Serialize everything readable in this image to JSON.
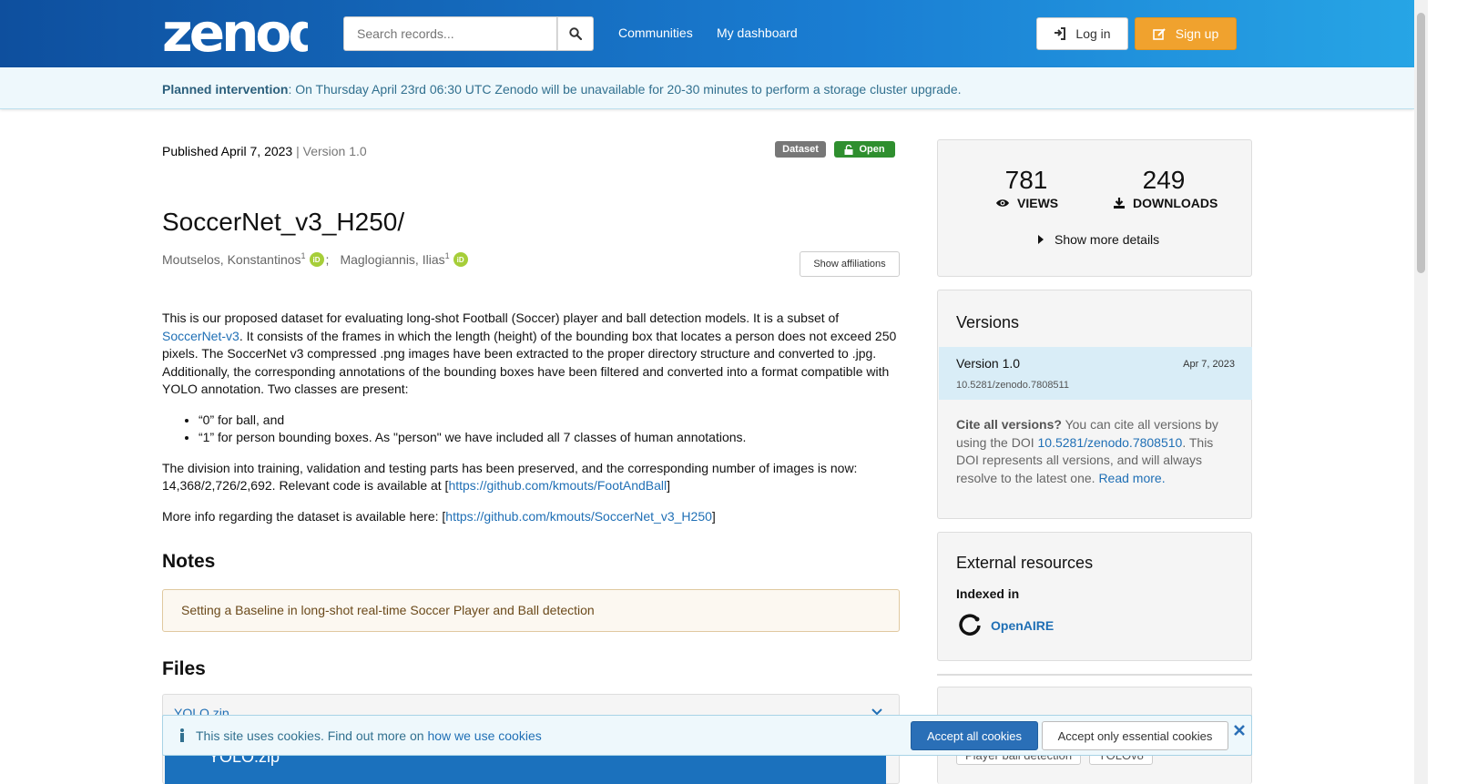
{
  "header": {
    "logo_text": "zenodo",
    "search_placeholder": "Search records...",
    "nav": [
      "Communities",
      "My dashboard"
    ],
    "login_label": "Log in",
    "signup_label": "Sign up"
  },
  "banner": {
    "bold": "Planned intervention",
    "text": ": On Thursday April 23rd 06:30 UTC Zenodo will be unavailable for 20-30 minutes to perform a storage cluster upgrade."
  },
  "record": {
    "published": "Published April 7, 2023",
    "separator": " | ",
    "version": "Version 1.0",
    "badge_type": "Dataset",
    "badge_access": "Open",
    "title": "SoccerNet_v3_H250/",
    "authors": [
      {
        "name": "Moutselos, Konstantinos",
        "aff": "1"
      },
      {
        "name": "Maglogiannis, Ilias",
        "aff": "1"
      }
    ],
    "author_sep": ";",
    "orcid_text": "iD",
    "show_affiliations": "Show affiliations"
  },
  "description": {
    "p1_a": "This is our proposed dataset for evaluating long-shot Football (Soccer) player and ball detection models. It is a subset of ",
    "p1_link": "SoccerNet-v3",
    "p1_b": ". It consists of the frames in which the length (height) of the bounding box that locates a person does not exceed 250 pixels. The SoccerNet v3 compressed .png images have been extracted to the proper directory structure and converted to .jpg. Additionally, the corresponding annotations of the bounding boxes have been filtered and converted into a format compatible with YOLO annotation. Two classes are present:",
    "bullets": [
      "“0” for ball, and",
      "“1” for person bounding boxes. As \"person\" we have included all 7 classes of human annotations."
    ],
    "p2_a": "The division into training, validation and testing parts has been preserved, and the corresponding number of images is now: 14,368/2,726/2,692. Relevant code is available at [",
    "p2_link": "https://github.com/kmouts/FootAndBall",
    "p2_b": "]",
    "p3_a": "More info regarding the dataset is available here: [",
    "p3_link": "https://github.com/kmouts/SoccerNet_v3_H250",
    "p3_b": "]"
  },
  "notes": {
    "heading": "Notes",
    "text": "Setting a Baseline in long-shot real-time Soccer Player and Ball detection"
  },
  "files": {
    "heading": "Files",
    "file_name": "YOLO.zip",
    "row_name": "YOLO.zip"
  },
  "stats": {
    "views": "781",
    "views_label": "VIEWS",
    "downloads": "249",
    "downloads_label": "DOWNLOADS",
    "more": "Show more details"
  },
  "versions": {
    "heading": "Versions",
    "label": "Version 1.0",
    "date": "Apr 7, 2023",
    "doi": "10.5281/zenodo.7808511",
    "cite_bold": "Cite all versions?",
    "cite_a": " You can cite all versions by using the DOI ",
    "cite_doi": "10.5281/zenodo.7808510",
    "cite_b": ". This DOI represents all versions, and will always resolve to the latest one. ",
    "read_more": "Read more."
  },
  "external": {
    "heading": "External resources",
    "indexed": "Indexed in",
    "openaire": "OpenAIRE"
  },
  "keywords": [
    "Player ball detection",
    "YOLOv8"
  ],
  "cookie": {
    "text": "This site uses cookies. Find out more on ",
    "link": "how we use cookies",
    "accept_all": "Accept all cookies",
    "accept_essential": "Accept only essential cookies"
  },
  "colors": {
    "header_start": "#0e4f9e",
    "header_end": "#27a6e6",
    "signup": "#f0a22e",
    "open_badge": "#2f8f2f",
    "dataset_badge": "#777777",
    "link": "#1f6fb5"
  }
}
